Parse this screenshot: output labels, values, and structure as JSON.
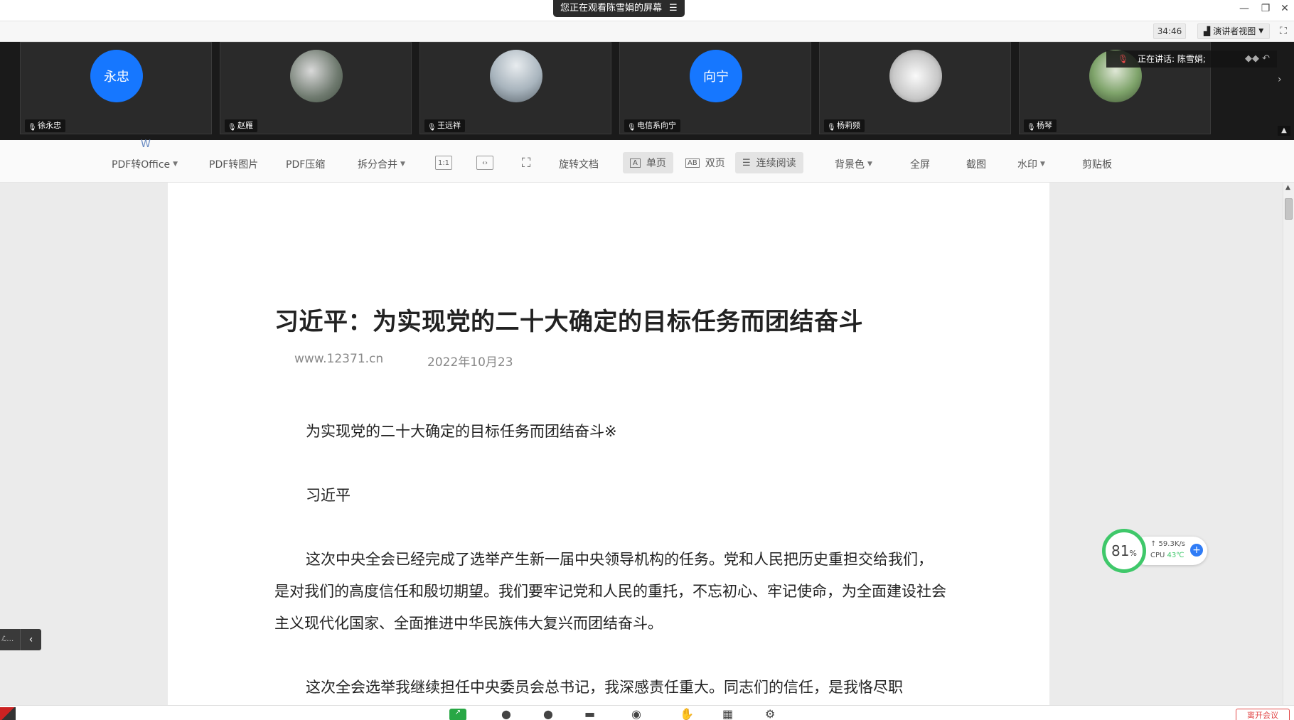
{
  "titlebar": {
    "share_notice": "您正在观看陈雪娟的屏幕"
  },
  "meetbar": {
    "timer": "34:46",
    "view_mode": "演讲者视图"
  },
  "participants": [
    {
      "name": "徐永忠",
      "avatar_text": "永忠"
    },
    {
      "name": "赵雁",
      "avatar_text": ""
    },
    {
      "name": "王远祥",
      "avatar_text": ""
    },
    {
      "name": "电信系向宁",
      "avatar_text": "向宁"
    },
    {
      "name": "杨莉频",
      "avatar_text": ""
    },
    {
      "name": "杨琴",
      "avatar_text": ""
    }
  ],
  "speaking": "正在讲话: 陈雪娟;",
  "toolbar": {
    "pdf_to_office": "PDF转Office",
    "pdf_to_image": "PDF转图片",
    "pdf_compress": "PDF压缩",
    "split_merge": "拆分合并",
    "rotate_doc": "旋转文档",
    "single_page": "单页",
    "double_page": "双页",
    "continuous": "连续阅读",
    "background_color": "背景色",
    "fullscreen": "全屏",
    "screenshot": "截图",
    "watermark": "水印",
    "clipboard": "剪贴板"
  },
  "document": {
    "title": "习近平：为实现党的二十大确定的目标任务而团结奋斗",
    "source": "www.12371.cn",
    "date": "2022年10月23",
    "subtitle": "为实现党的二十大确定的目标任务而团结奋斗※",
    "author": "习近平",
    "para1": "这次中央全会已经完成了选举产生新一届中央领导机构的任务。党和人民把历史重担交给我们，是对我们的高度信任和殷切期望。我们要牢记党和人民的重托，不忘初心、牢记使命，为全面建设社会主义现代化国家、全面推进中华民族伟大复兴而团结奋斗。",
    "para2": "这次全会选举我继续担任中央委员会总书记，我深感责任重大。同志们的信任，是我恪尽职"
  },
  "monitor": {
    "cpu_percent": "81",
    "percent_sign": "%",
    "net_speed": "↑ 59.3K/s",
    "cpu_label": "CPU",
    "cpu_temp": "43℃"
  },
  "bottombar": {
    "leave_label": "离开会议"
  },
  "colors": {
    "accent": "#1677ff",
    "speaking_mic": "#e04848",
    "cpu_ring": "#3fc86a",
    "leave": "#e24848"
  }
}
